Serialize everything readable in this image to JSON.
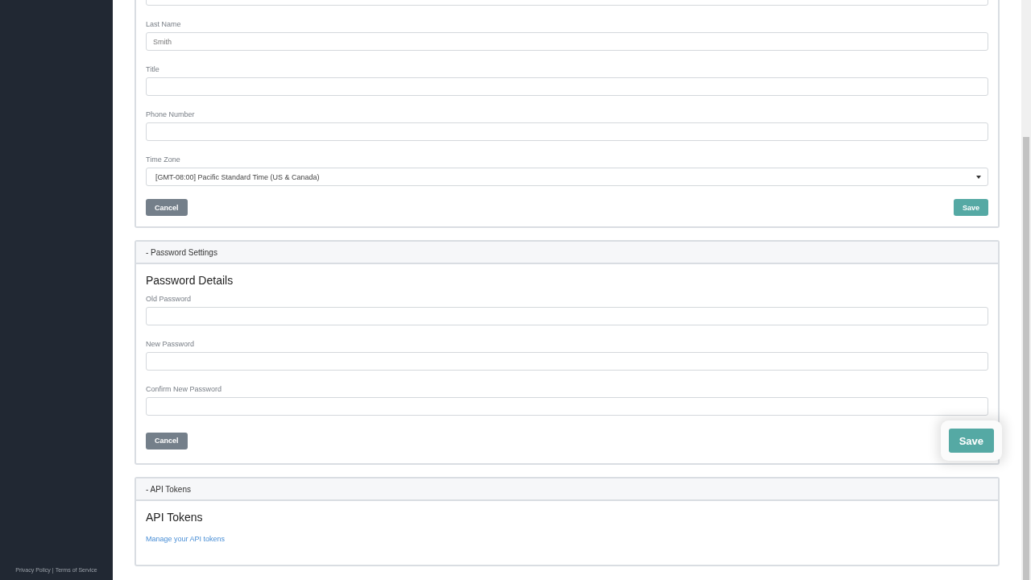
{
  "sidebar": {
    "footer_links": [
      "Privacy Policy",
      "Terms of Service"
    ],
    "separator": "|"
  },
  "cards": [
    {
      "fields": [
        {
          "kind": "text"
        },
        {
          "kind": "text",
          "label": "Last Name",
          "value": "Smith"
        },
        {
          "kind": "text",
          "label": "Title"
        },
        {
          "kind": "text",
          "label": "Phone Number"
        },
        {
          "kind": "select",
          "label": "Time Zone",
          "value": "[GMT-08:00] Pacific Standard Time (US & Canada)"
        }
      ],
      "buttons": [
        {
          "kind": "cancel",
          "label": "Cancel",
          "highlighted": false
        },
        {
          "kind": "save",
          "label": "Save",
          "highlighted": false
        }
      ]
    },
    {
      "header": "- Password Settings",
      "title": "Password Details",
      "fields": [
        {
          "kind": "password",
          "label": "Old Password"
        },
        {
          "kind": "password",
          "label": "New Password"
        },
        {
          "kind": "password",
          "label": "Confirm New Password"
        }
      ],
      "buttons": [
        {
          "kind": "cancel",
          "label": "Cancel",
          "highlighted": false
        },
        {
          "kind": "save",
          "label": "Save",
          "highlighted": true
        }
      ]
    },
    {
      "header": "- API Tokens",
      "title": "API Tokens",
      "link": "Manage your API tokens"
    }
  ]
}
